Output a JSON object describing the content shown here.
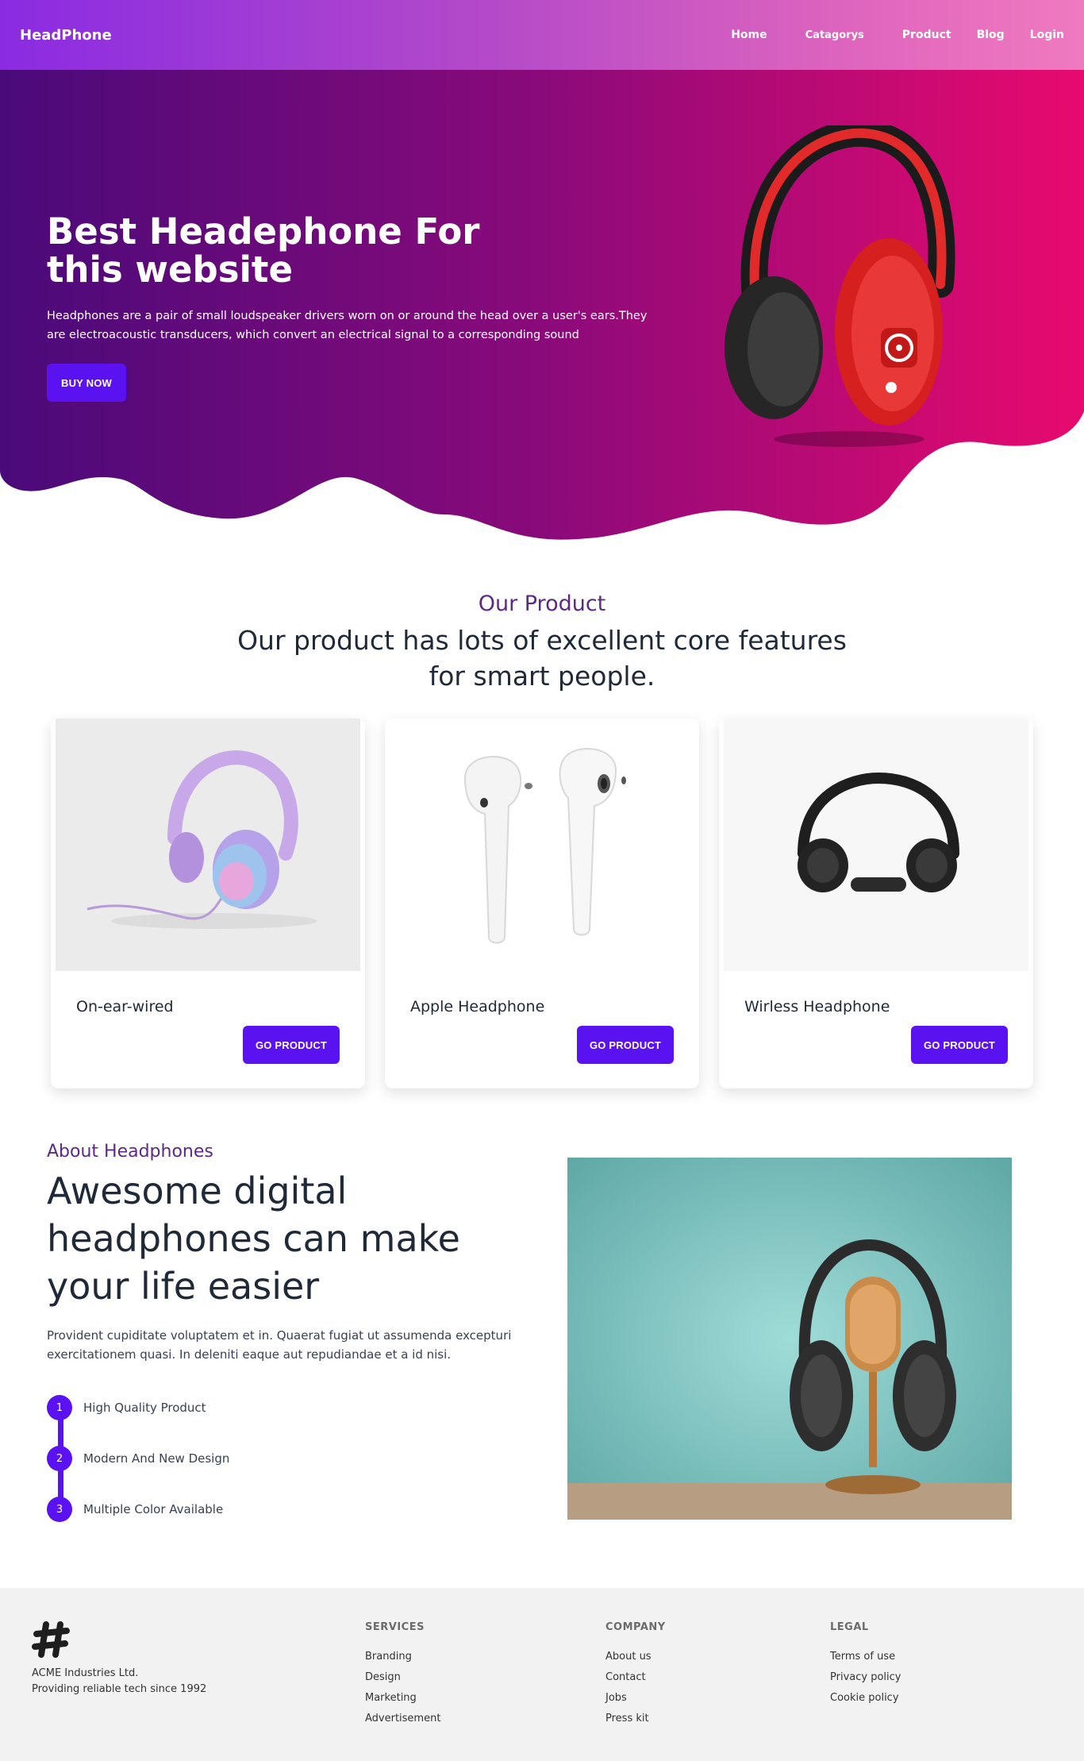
{
  "nav": {
    "brand": "HeadPhone",
    "links": [
      "Home",
      "Catagorys",
      "Product",
      "Blog",
      "Login"
    ]
  },
  "hero": {
    "title": "Best Headephone For this website",
    "description": "Headphones are a pair of small loudspeaker drivers worn on or around the head over a user's ears.They are electroacoustic transducers, which convert an electrical signal to a corresponding sound",
    "button": "BUY NOW",
    "colors": {
      "left": "#4a0a7a",
      "mid": "#8a0a7a",
      "right": "#e80a6e"
    }
  },
  "products": {
    "subtitle": "Our Product",
    "title": "Our product has lots of excellent core features for smart people.",
    "items": [
      {
        "name": "On-ear-wired",
        "button": "GO PRODUCT"
      },
      {
        "name": "Apple Headphone",
        "button": "GO PRODUCT"
      },
      {
        "name": "Wirless Headphone",
        "button": "GO PRODUCT"
      }
    ]
  },
  "about": {
    "subtitle": "About Headphones",
    "title": "Awesome digital headphones can make your life easier",
    "description": "Provident cupiditate voluptatem et in. Quaerat fugiat ut assumenda excepturi exercitationem quasi. In deleniti eaque aut repudiandae et a id nisi.",
    "steps": [
      {
        "num": "1",
        "label": "High Quality Product"
      },
      {
        "num": "2",
        "label": "Modern And New Design"
      },
      {
        "num": "3",
        "label": "Multiple Color Available"
      }
    ]
  },
  "footer": {
    "company_name": "ACME Industries Ltd.",
    "company_tagline": "Providing reliable tech since 1992",
    "columns": [
      {
        "title": "SERVICES",
        "links": [
          "Branding",
          "Design",
          "Marketing",
          "Advertisement"
        ]
      },
      {
        "title": "COMPANY",
        "links": [
          "About us",
          "Contact",
          "Jobs",
          "Press kit"
        ]
      },
      {
        "title": "LEGAL",
        "links": [
          "Terms of use",
          "Privacy policy",
          "Cookie policy"
        ]
      }
    ]
  },
  "accent_color": "#5b12f0"
}
